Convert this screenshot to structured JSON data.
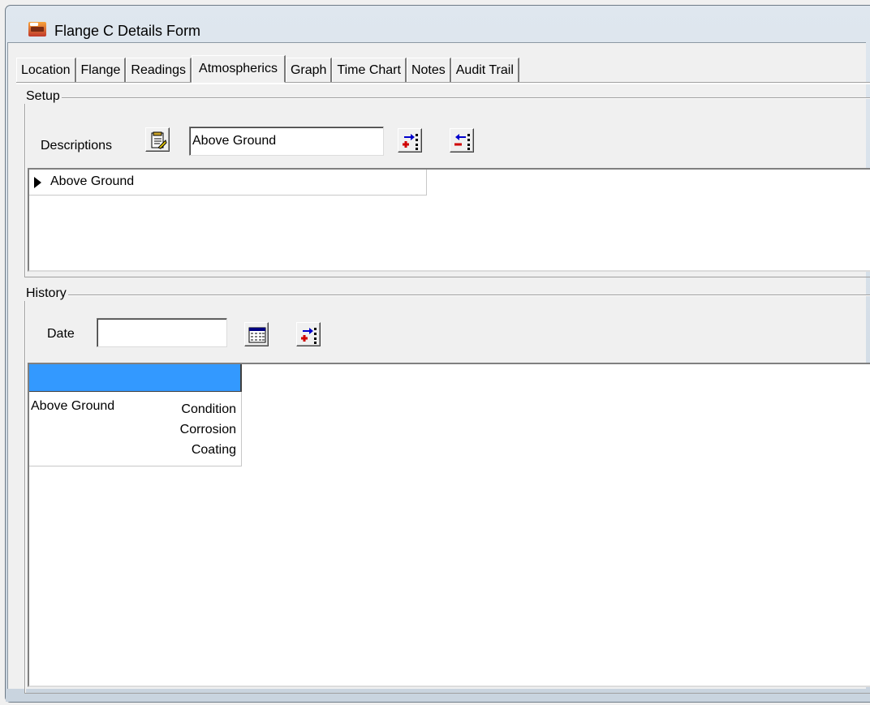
{
  "window": {
    "title": "Flange C Details Form"
  },
  "tabs": [
    {
      "label": "Location"
    },
    {
      "label": "Flange"
    },
    {
      "label": "Readings"
    },
    {
      "label": "Atmospherics"
    },
    {
      "label": "Graph"
    },
    {
      "label": "Time Chart"
    },
    {
      "label": "Notes"
    },
    {
      "label": "Audit Trail"
    }
  ],
  "setup": {
    "group_label": "Setup",
    "descriptions_label": "Descriptions",
    "descriptions_value": "Above Ground",
    "rows": [
      {
        "text": "Above Ground"
      }
    ]
  },
  "history": {
    "group_label": "History",
    "date_label": "Date",
    "date_value": "",
    "row_name": "Above Ground",
    "attributes": [
      "Condition",
      "Corrosion",
      "Coating"
    ]
  },
  "colors": {
    "selection": "#3399ff",
    "add": "#d00000",
    "arrow": "#0000cc"
  },
  "icons": [
    "app-icon",
    "notepad-icon",
    "add-record-icon",
    "remove-record-icon",
    "calendar-icon",
    "add-history-icon",
    "row-pointer-icon"
  ]
}
